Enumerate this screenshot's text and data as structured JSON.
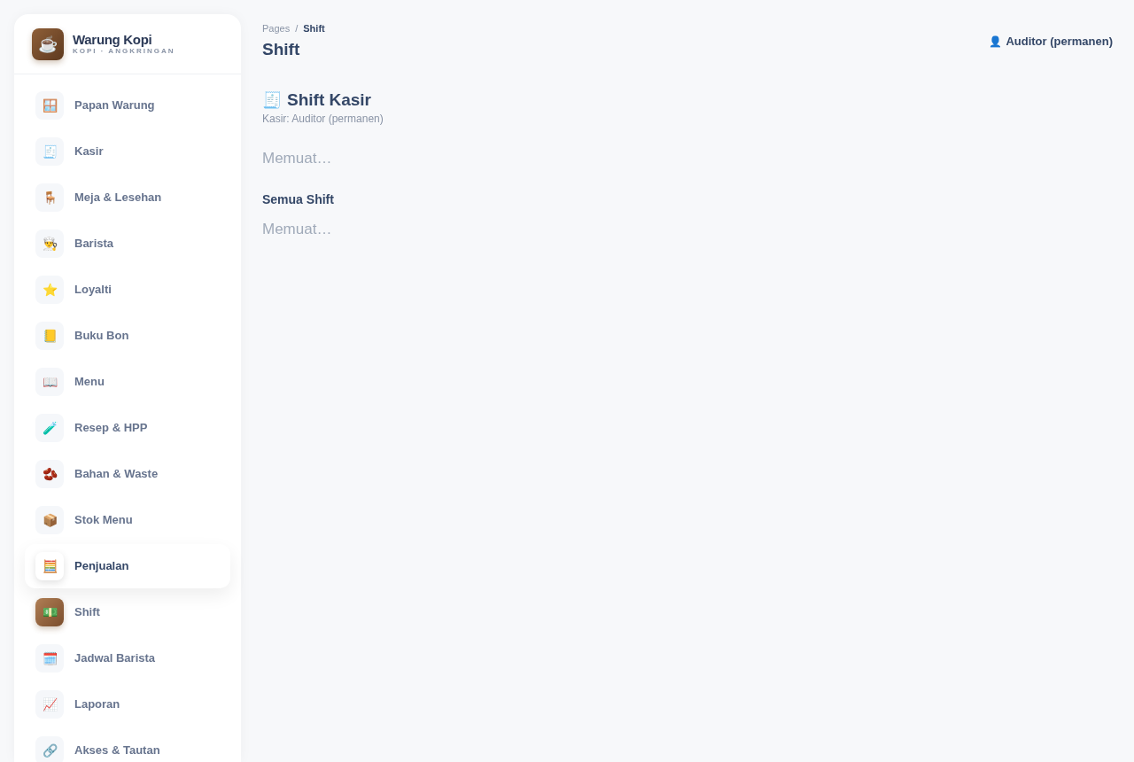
{
  "sidebar": {
    "brand": {
      "icon": "☕",
      "name": "Warung Kopi",
      "tagline": "KOPI · ANGKRINGAN"
    },
    "items": [
      {
        "icon": "🪟",
        "label": "Papan Warung",
        "hovered": false,
        "active": false
      },
      {
        "icon": "🧾",
        "label": "Kasir",
        "hovered": false,
        "active": false
      },
      {
        "icon": "🪑",
        "label": "Meja & Lesehan",
        "hovered": false,
        "active": false
      },
      {
        "icon": "👨‍🍳",
        "label": "Barista",
        "hovered": false,
        "active": false
      },
      {
        "icon": "⭐",
        "label": "Loyalti",
        "hovered": false,
        "active": false
      },
      {
        "icon": "📒",
        "label": "Buku Bon",
        "hovered": false,
        "active": false
      },
      {
        "icon": "📖",
        "label": "Menu",
        "hovered": false,
        "active": false
      },
      {
        "icon": "🧪",
        "label": "Resep & HPP",
        "hovered": false,
        "active": false
      },
      {
        "icon": "🫘",
        "label": "Bahan & Waste",
        "hovered": false,
        "active": false
      },
      {
        "icon": "📦",
        "label": "Stok Menu",
        "hovered": false,
        "active": false
      },
      {
        "icon": "🧮",
        "label": "Penjualan",
        "hovered": true,
        "active": false
      },
      {
        "icon": "💵",
        "label": "Shift",
        "hovered": false,
        "active": true
      },
      {
        "icon": "🗓️",
        "label": "Jadwal Barista",
        "hovered": false,
        "active": false
      },
      {
        "icon": "📈",
        "label": "Laporan",
        "hovered": false,
        "active": false
      },
      {
        "icon": "🔗",
        "label": "Akses & Tautan",
        "hovered": false,
        "active": false
      }
    ]
  },
  "header": {
    "breadcrumb": [
      "Pages",
      "Shift"
    ],
    "separator": "/",
    "title": "Shift",
    "user": {
      "icon": "👤",
      "name": "Auditor (permanen)"
    }
  },
  "sections": [
    {
      "kind": "primary",
      "icon": "🧾",
      "title": "Shift Kasir",
      "subtitle": "Kasir: Auditor (permanen)",
      "status": "Memuat…"
    },
    {
      "kind": "secondary",
      "title": "Semua Shift",
      "status": "Memuat…"
    }
  ]
}
